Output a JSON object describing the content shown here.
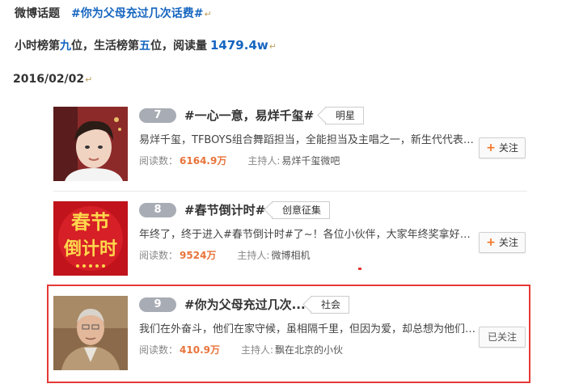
{
  "header": {
    "label": "微博话题",
    "hashtag": "#你为父母充过几次话费#",
    "rank_prefix": "小时榜第",
    "hour_rank": "九",
    "rank_mid": "位，生活榜第",
    "life_rank": "五",
    "rank_suffix": "位，阅读量",
    "read_count": "1479.4w",
    "date": "2016/02/02",
    "para_mark": "↵"
  },
  "topics": [
    {
      "rank": "7",
      "title": "#一心一意，易烊千玺#",
      "category": "明星",
      "description": "易烊千玺，TFBOYS组合舞蹈担当，全能担当及主唱之一，新生代代表人物...",
      "reads_label": "阅读数：",
      "reads": "6164.9万",
      "host_label": "主持人:",
      "host": "易烊千玺微吧",
      "follow_label": "关注",
      "followed": false
    },
    {
      "rank": "8",
      "title": "#春节倒计时#",
      "category": "创意征集",
      "description": "年终了，终于进入#春节倒计时#了~！各位小伙伴，大家年终奖拿好了吗？...",
      "reads_label": "阅读数：",
      "reads": "9524万",
      "host_label": "主持人:",
      "host": "微博相机",
      "follow_label": "关注",
      "followed": false,
      "thumb_text_1": "春节",
      "thumb_text_2": "倒计时"
    },
    {
      "rank": "9",
      "title": "#你为父母充过几次...",
      "category": "社会",
      "description": "我们在外奋斗，他们在家守候，虽相隔千里，但因为爱，却总想为他们做...",
      "reads_label": "阅读数：",
      "reads": "410.9万",
      "host_label": "主持人:",
      "host": "飘在北京的小伙",
      "follow_label": "已关注",
      "followed": true
    }
  ],
  "colors": {
    "accent_blue": "#1565c0",
    "reads_orange": "#e8743b",
    "highlight_red": "#e53935",
    "badge_gray": "#a8acb4"
  }
}
